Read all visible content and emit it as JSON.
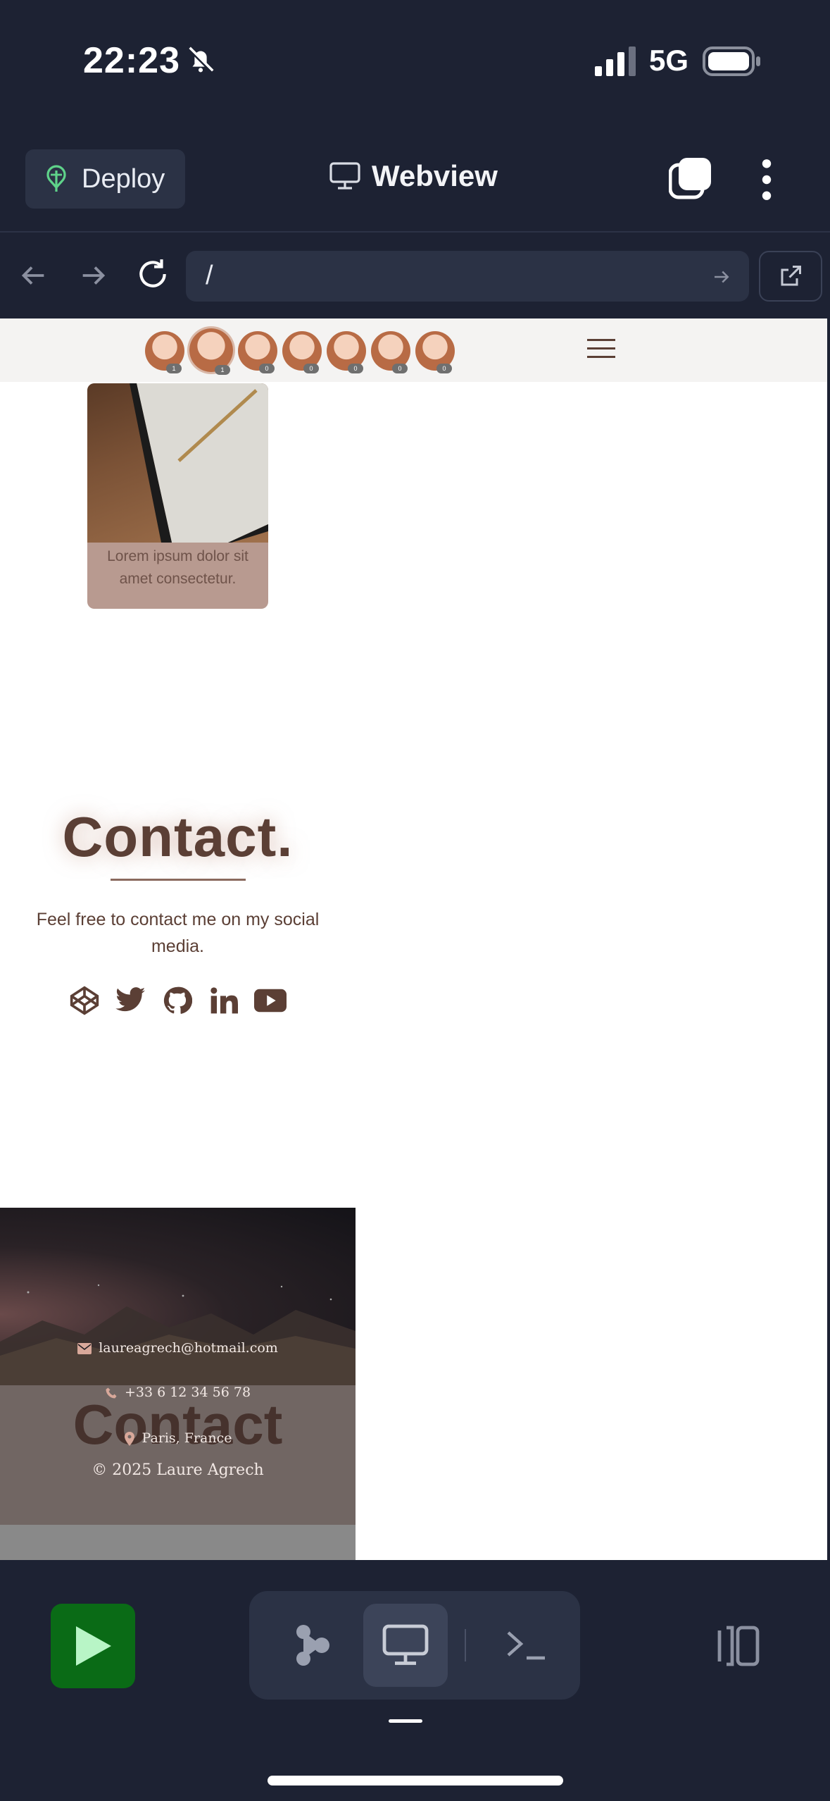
{
  "status_bar": {
    "time": "22:23",
    "network": "5G"
  },
  "header": {
    "deploy_label": "Deploy",
    "title": "Webview"
  },
  "url_bar": {
    "url": "/"
  },
  "site": {
    "card_caption": "Lorem ipsum dolor sit amet consectetur.",
    "contact_title": "Contact.",
    "contact_text": "Feel free to contact me on my social media.",
    "social_icons": [
      "codepen-icon",
      "twitter-icon",
      "github-icon",
      "linkedin-icon",
      "youtube-icon"
    ],
    "ghost_title": "Contact",
    "footer": {
      "email": "laureagrech@hotmail.com",
      "phone": "+33 6 12 34 56 78",
      "location": "Paris, France",
      "copyright": "© 2025 Laure Agrech"
    }
  },
  "colors": {
    "accent_brown": "#5b3f35",
    "run_green": "#0a6b16",
    "app_bg": "#1d2233"
  }
}
